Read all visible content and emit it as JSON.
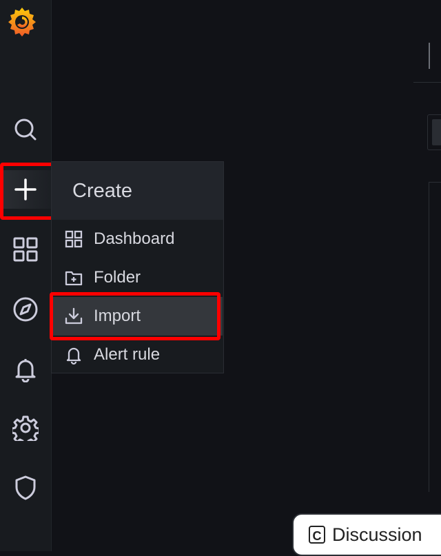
{
  "sidebar": {
    "items": [
      {
        "icon": "search-icon"
      },
      {
        "icon": "plus-icon",
        "active": true
      },
      {
        "icon": "dashboards-icon"
      },
      {
        "icon": "compass-icon"
      },
      {
        "icon": "bell-icon"
      },
      {
        "icon": "gear-icon"
      },
      {
        "icon": "shield-icon"
      }
    ]
  },
  "flyout": {
    "title": "Create",
    "items": [
      {
        "label": "Dashboard",
        "icon": "dashboard-grid-icon"
      },
      {
        "label": "Folder",
        "icon": "folder-plus-icon"
      },
      {
        "label": "Import",
        "icon": "import-icon",
        "selected": true
      },
      {
        "label": "Alert rule",
        "icon": "bell-icon"
      }
    ]
  },
  "discussion": {
    "label": "Discussion",
    "icon_letter": "C"
  },
  "colors": {
    "background": "#111217",
    "sidebar": "#181b1f",
    "highlight": "#ff0000",
    "logo_orange": "#f05a28"
  }
}
